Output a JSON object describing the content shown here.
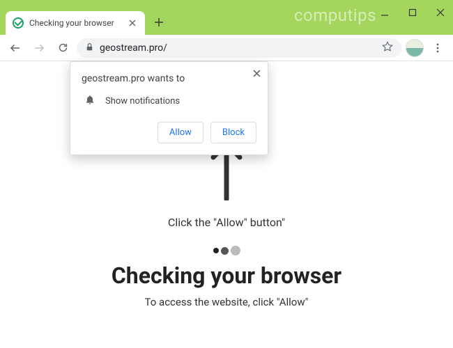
{
  "tab": {
    "title": "Checking your browser"
  },
  "watermark": "computips",
  "omnibox": {
    "url": "geostream.pro/"
  },
  "permission": {
    "title": "geostream.pro wants to",
    "item": "Show notifications",
    "allow": "Allow",
    "block": "Block"
  },
  "page": {
    "instruction1": "Click the \"Allow\" button\"",
    "heading": "Checking your browser",
    "instruction2": "To access the website, click \"Allow\""
  }
}
